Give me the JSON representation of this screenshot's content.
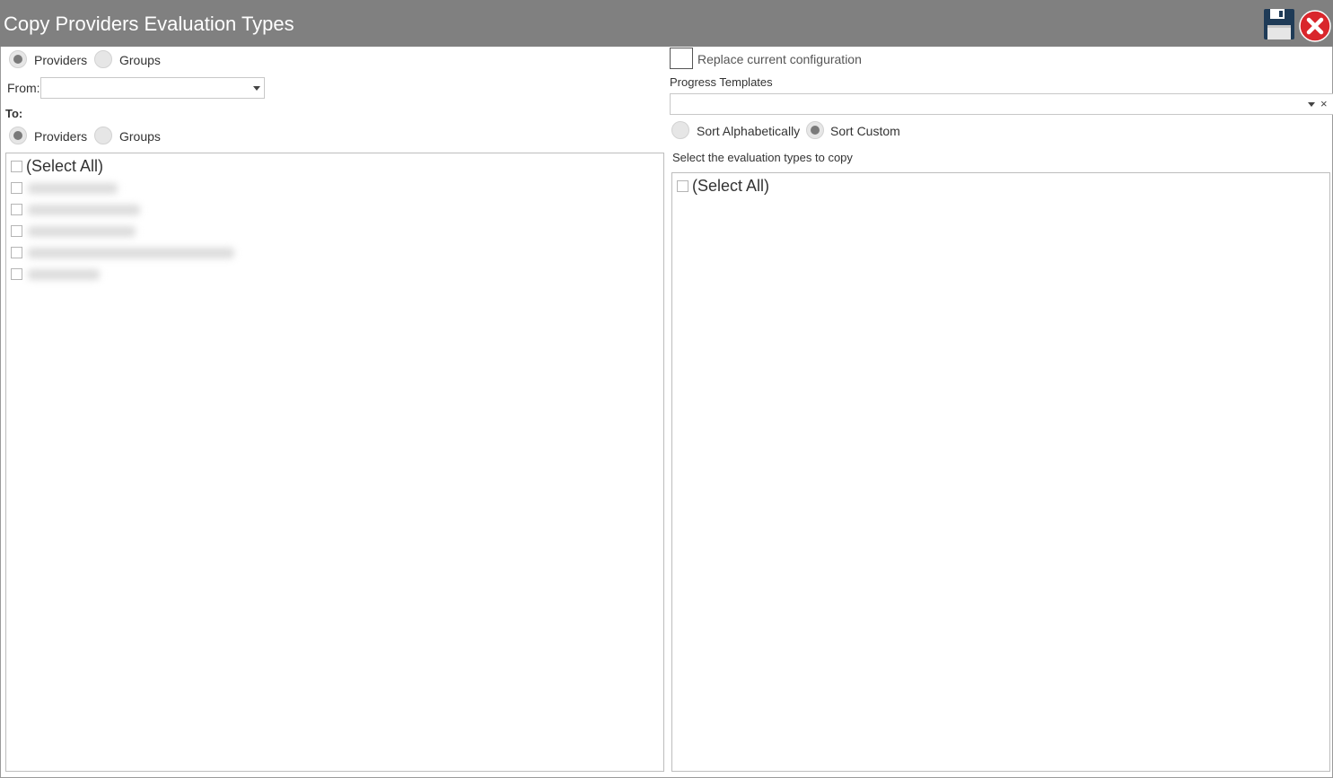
{
  "window": {
    "title": "Copy Providers Evaluation Types",
    "save_icon": "save-icon",
    "close_icon": "close-icon",
    "titlebar_color": "#808080",
    "close_color": "#d9262c"
  },
  "left": {
    "from_type": {
      "options": [
        "Providers",
        "Groups"
      ],
      "selected": "Providers"
    },
    "from_label": "From:",
    "from_value": "",
    "to_label": "To:",
    "to_type": {
      "options": [
        "Providers",
        "Groups"
      ],
      "selected": "Providers"
    },
    "list": {
      "select_all": "(Select All)",
      "items_redacted_count": 5
    }
  },
  "right": {
    "replace_label": "Replace current configuration",
    "replace_checked": false,
    "progress_templates_label": "Progress Templates",
    "progress_templates_value": "",
    "clear_symbol": "×",
    "sort": {
      "options": [
        "Sort Alphabetically",
        "Sort Custom"
      ],
      "selected": "Sort Custom"
    },
    "eval_label": "Select the evaluation types to copy",
    "list": {
      "select_all": "(Select All)"
    }
  }
}
